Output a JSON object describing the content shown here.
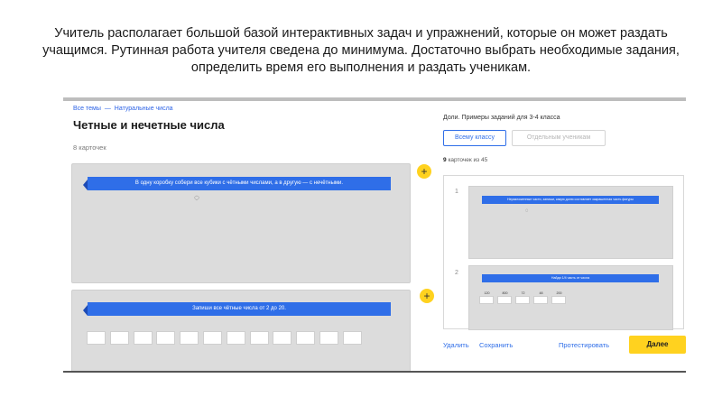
{
  "caption": {
    "line1": "Учитель располагает большой базой интерактивных задач и упражнений, которые он может раздать",
    "line2": "учащимся. Рутинная работа учителя сведена до минимума. Достаточно выбрать необходимые задания,",
    "line3": "определить время его выполнения и раздать ученикам."
  },
  "breadcrumb": {
    "all_topics": "Все темы",
    "separator": "—",
    "current": "Натуральные числа"
  },
  "lesson": {
    "title": "Четные и нечетные числа",
    "card_count": "8 карточек",
    "cards": [
      {
        "task": "В одну коробку собери все кубики с чётными числами, а в другую — с нечётными.",
        "spinner": "◌"
      },
      {
        "task": "Запиши все чётные числа от 2 до 20."
      }
    ],
    "add_symbol": "+"
  },
  "assign": {
    "section_title": "Доли. Примеры заданий для 3-4 класса",
    "btn_all": "Всему классу",
    "btn_individual": "Отдельным ученикам",
    "picked_count": "9",
    "picked_suffix": "карточек из 45",
    "preview": [
      {
        "num": "1",
        "task": "Неразложенные части, запиши, какую долю составляет закрашенная часть фигуры",
        "spinner": "◌"
      },
      {
        "num": "2",
        "task": "Найди 1/4 часть от числа",
        "options": [
          "120",
          "800",
          "72",
          "48",
          "200"
        ]
      }
    ],
    "delete_label": "Удалить",
    "save_label": "Сохранить",
    "test_label": "Протестировать",
    "next_label": "Далее"
  },
  "colors": {
    "accent": "#2f6ee8",
    "yellow": "#ffd21f",
    "card_bg": "#dcdcdc"
  }
}
